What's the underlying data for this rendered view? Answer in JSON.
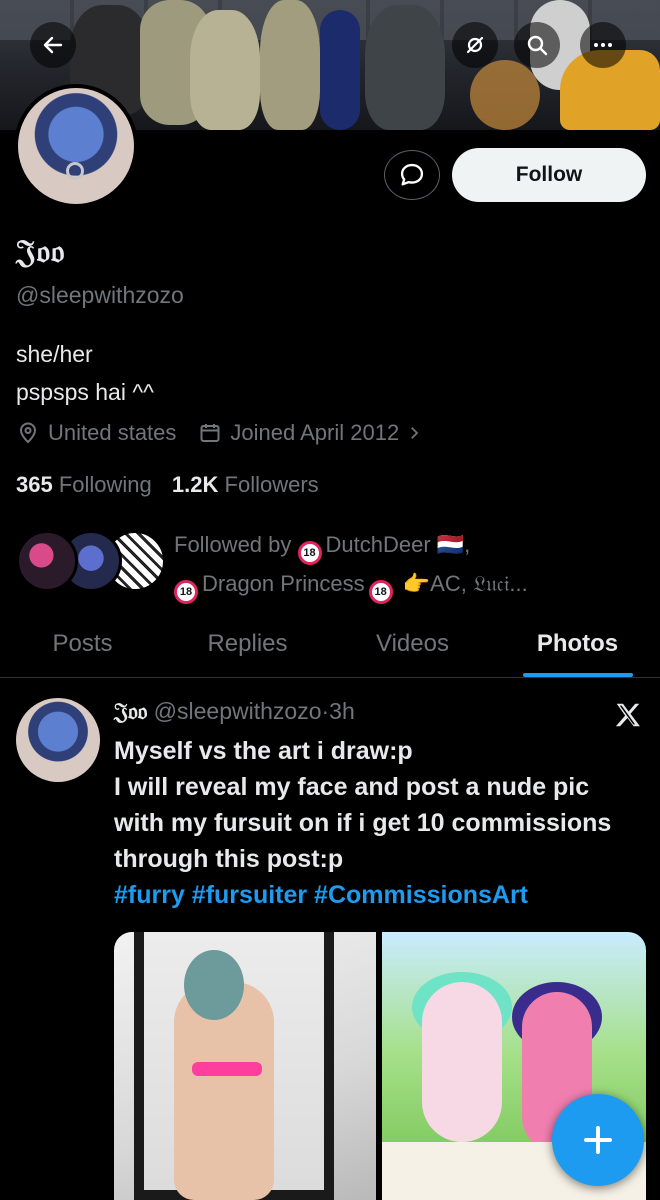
{
  "profile": {
    "display_name": "𝔍𝔬𝔬",
    "handle": "@sleepwithzozo",
    "bio_line1": "she/her",
    "bio_line2": "pspsps hai ^^",
    "location": "United states",
    "joined": "Joined April 2012",
    "following_count": "365",
    "following_label": "Following",
    "followers_count": "1.2K",
    "followers_label": "Followers",
    "followed_by_prefix": "Followed by",
    "followed_by_name1": "DutchDeer 🇳🇱,",
    "followed_by_name2": "Dragon Princess",
    "followed_by_rest": "👉AC, 𝔏𝔲𝔠𝔦...",
    "badge_text": "18"
  },
  "actions": {
    "follow_label": "Follow"
  },
  "tabs": [
    {
      "label": "Posts"
    },
    {
      "label": "Replies"
    },
    {
      "label": "Videos"
    },
    {
      "label": "Photos"
    }
  ],
  "post": {
    "author_name": "𝔍𝔬𝔬",
    "author_handle": "@sleepwithzozo",
    "separator": "·",
    "time": "3h",
    "text_line1": "Myself vs the art i draw:p",
    "text_line2": "I will reveal my face and post a nude pic with my fursuit on if i get 10 commissions through this post:p",
    "hashtags": "#furry #fursuiter #CommissionsArt"
  },
  "icons": {
    "back": "back-arrow-icon",
    "hide": "eye-off-icon",
    "search": "search-icon",
    "more": "more-icon",
    "message": "message-icon",
    "location": "location-pin-icon",
    "calendar": "calendar-icon",
    "x_logo": "x-logo-icon",
    "compose": "plus-icon"
  },
  "colors": {
    "accent": "#1d9bf0",
    "background": "#000000",
    "text_primary": "#e7e9ea",
    "text_secondary": "#71767b"
  }
}
